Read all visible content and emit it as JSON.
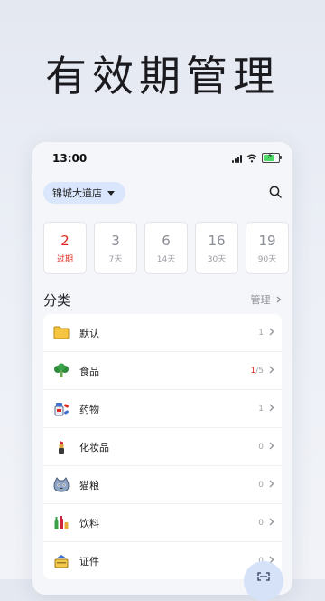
{
  "headline": "有效期管理",
  "status_bar": {
    "time": "13:00"
  },
  "store_selector": {
    "label": "锦城大道店"
  },
  "date_filters": [
    {
      "count": "2",
      "label": "过期"
    },
    {
      "count": "3",
      "label": "7天"
    },
    {
      "count": "6",
      "label": "14天"
    },
    {
      "count": "16",
      "label": "30天"
    },
    {
      "count": "19",
      "label": "90天"
    }
  ],
  "categories_section": {
    "title": "分类",
    "manage_label": "管理"
  },
  "categories": [
    {
      "name": "默认",
      "icon": "folder-icon",
      "count": "1"
    },
    {
      "name": "食品",
      "icon": "broccoli-icon",
      "count_highlight": "1",
      "count_rest": "/5"
    },
    {
      "name": "药物",
      "icon": "medicine-icon",
      "count": "1"
    },
    {
      "name": "化妆品",
      "icon": "lipstick-icon",
      "count": "0"
    },
    {
      "name": "猫粮",
      "icon": "cat-food-icon",
      "count": "0"
    },
    {
      "name": "饮料",
      "icon": "drinks-icon",
      "count": "0"
    },
    {
      "name": "证件",
      "icon": "id-card-icon",
      "count": "0"
    }
  ],
  "colors": {
    "expired_red": "#e0281d",
    "accent_blue": "#d9e6fb"
  }
}
